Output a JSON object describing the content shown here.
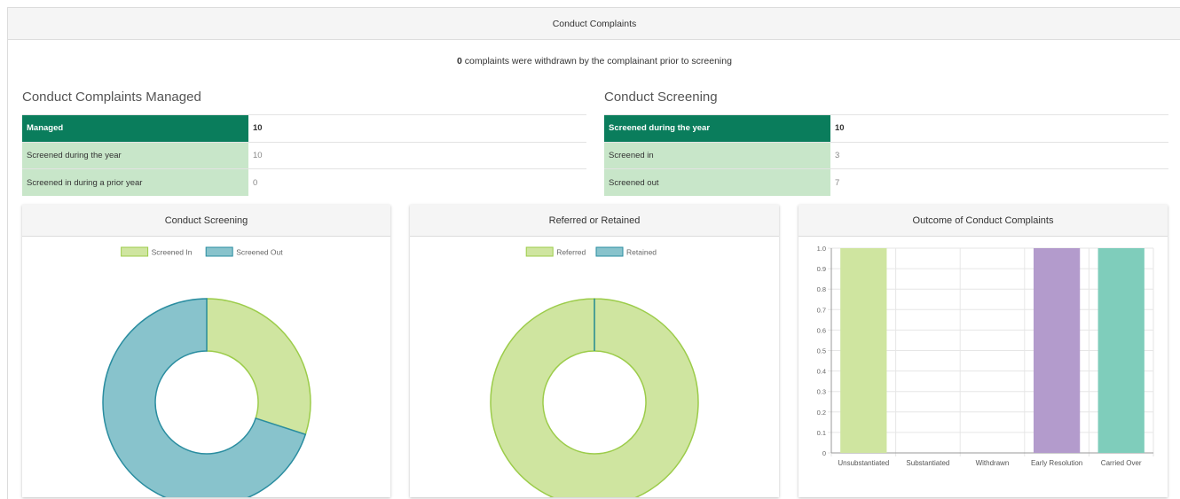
{
  "page": {
    "title": "Conduct Complaints",
    "withdrawn_count": "0",
    "withdrawn_text": " complaints were withdrawn by the complainant prior to screening"
  },
  "managed": {
    "title": "Conduct Complaints Managed",
    "rows": [
      {
        "label": "Managed",
        "value": "10"
      },
      {
        "label": "Screened during the year",
        "value": "10"
      },
      {
        "label": "Screened in during a prior year",
        "value": "0"
      }
    ]
  },
  "screening": {
    "title": "Conduct Screening",
    "rows": [
      {
        "label": "Screened during the year",
        "value": "10"
      },
      {
        "label": "Screened in",
        "value": "3"
      },
      {
        "label": "Screened out",
        "value": "7"
      }
    ]
  },
  "cards": {
    "screening_title": "Conduct Screening",
    "referred_title": "Referred or Retained",
    "outcome_title": "Outcome of Conduct Complaints"
  },
  "chart_data": [
    {
      "type": "pie",
      "title": "Conduct Screening",
      "donut": true,
      "legend_position": "top",
      "labels": [
        "Screened In",
        "Screened Out"
      ],
      "values": [
        3,
        7
      ],
      "colors": [
        "#cfe5a0",
        "#88c3cc"
      ],
      "borders": [
        "#9ccc4a",
        "#2a8da0"
      ]
    },
    {
      "type": "pie",
      "title": "Referred or Retained",
      "donut": true,
      "legend_position": "top",
      "labels": [
        "Referred",
        "Retained"
      ],
      "values": [
        1,
        0
      ],
      "colors": [
        "#cfe5a0",
        "#88c3cc"
      ],
      "borders": [
        "#9ccc4a",
        "#2a8da0"
      ]
    },
    {
      "type": "bar",
      "title": "Outcome of Conduct Complaints",
      "categories": [
        "Unsubstantiated",
        "Substantiated",
        "Withdrawn",
        "Early Resolution",
        "Carried Over"
      ],
      "values": [
        1,
        0,
        0,
        1,
        1
      ],
      "colors": [
        "#cfe5a0",
        "#cfe5a0",
        "#cfe5a0",
        "#b39bcc",
        "#7fcdbb"
      ],
      "ylim": [
        0,
        1.0
      ],
      "yticks": [
        "0",
        "0.1",
        "0.2",
        "0.3",
        "0.4",
        "0.5",
        "0.6",
        "0.7",
        "0.8",
        "0.9",
        "1.0"
      ],
      "grid": true
    }
  ]
}
